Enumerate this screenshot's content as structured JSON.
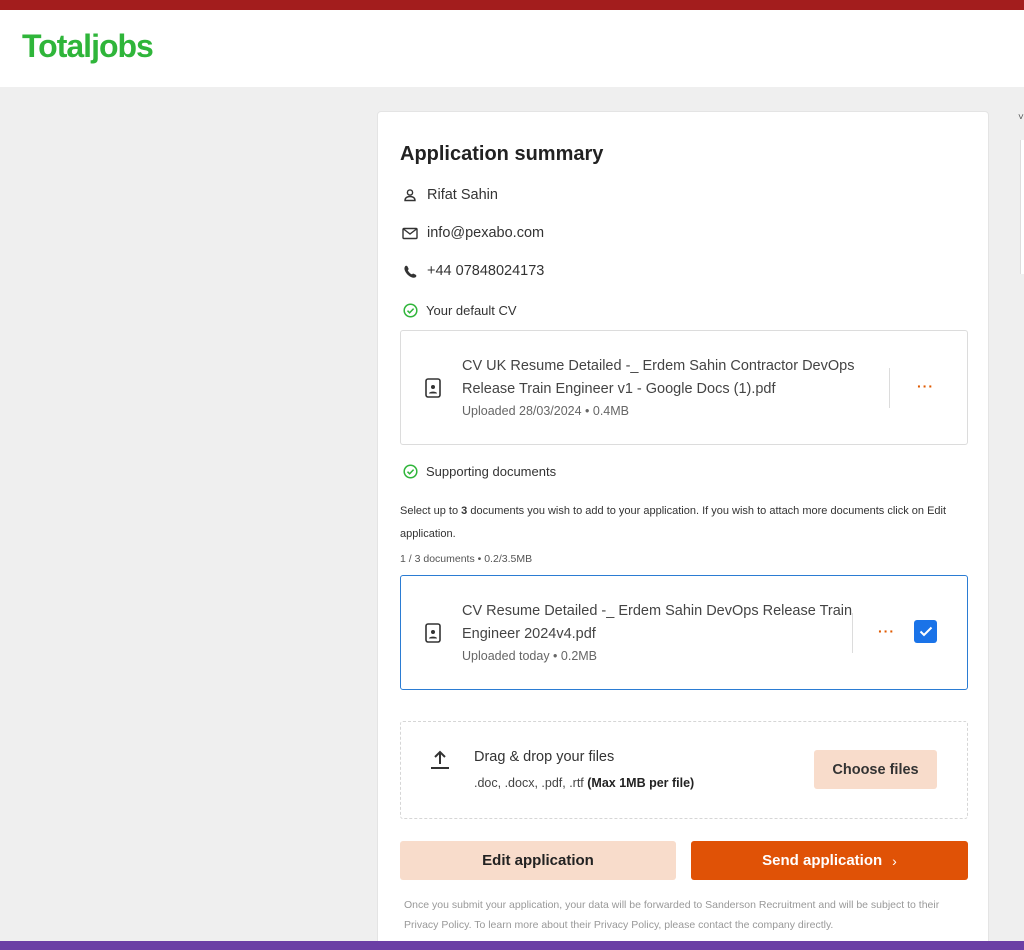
{
  "brand": {
    "logo_text": "Totaljobs",
    "logo_color": "#2fb53a",
    "topbar_color": "#a31d1d",
    "bottombar_color": "#6b3fa5"
  },
  "summary": {
    "title": "Application summary",
    "name": "Rifat Sahin",
    "email": "info@pexabo.com",
    "phone": "+44 07848024173",
    "icons": [
      "person-icon",
      "mail-icon",
      "phone-icon"
    ]
  },
  "default_cv": {
    "heading": "Your default CV",
    "file_name": "CV UK Resume Detailed -_ Erdem Sahin Contractor DevOps Release Train Engineer v1 - Google Docs (1).pdf",
    "meta": "Uploaded 28/03/2024 • 0.4MB",
    "menu_label": "···"
  },
  "supporting": {
    "heading": "Supporting documents",
    "help_pre": "Select up to ",
    "help_count": "3",
    "help_post": " documents you wish to add to your application. If you wish to attach more documents click on Edit application.",
    "count_text": "1 / 3 documents • 0.2/3.5MB",
    "file_name": "CV Resume Detailed -_ Erdem Sahin DevOps Release Train Engineer 2024v4.pdf",
    "meta": "Uploaded today • 0.2MB",
    "menu_label": "···",
    "checked": true
  },
  "upload": {
    "title": "Drag & drop your files",
    "types": ".doc, .docx, .pdf, .rtf ",
    "limit": "(Max 1MB per file)",
    "button": "Choose files"
  },
  "actions": {
    "edit": "Edit application",
    "send": "Send application",
    "send_chevron": "›",
    "accent": "#e05206"
  },
  "disclaimer": "Once you submit your application, your data will be forwarded to Sanderson Recruitment and will be subject to their Privacy Policy. To learn more about their Privacy Policy, please contact the company directly."
}
